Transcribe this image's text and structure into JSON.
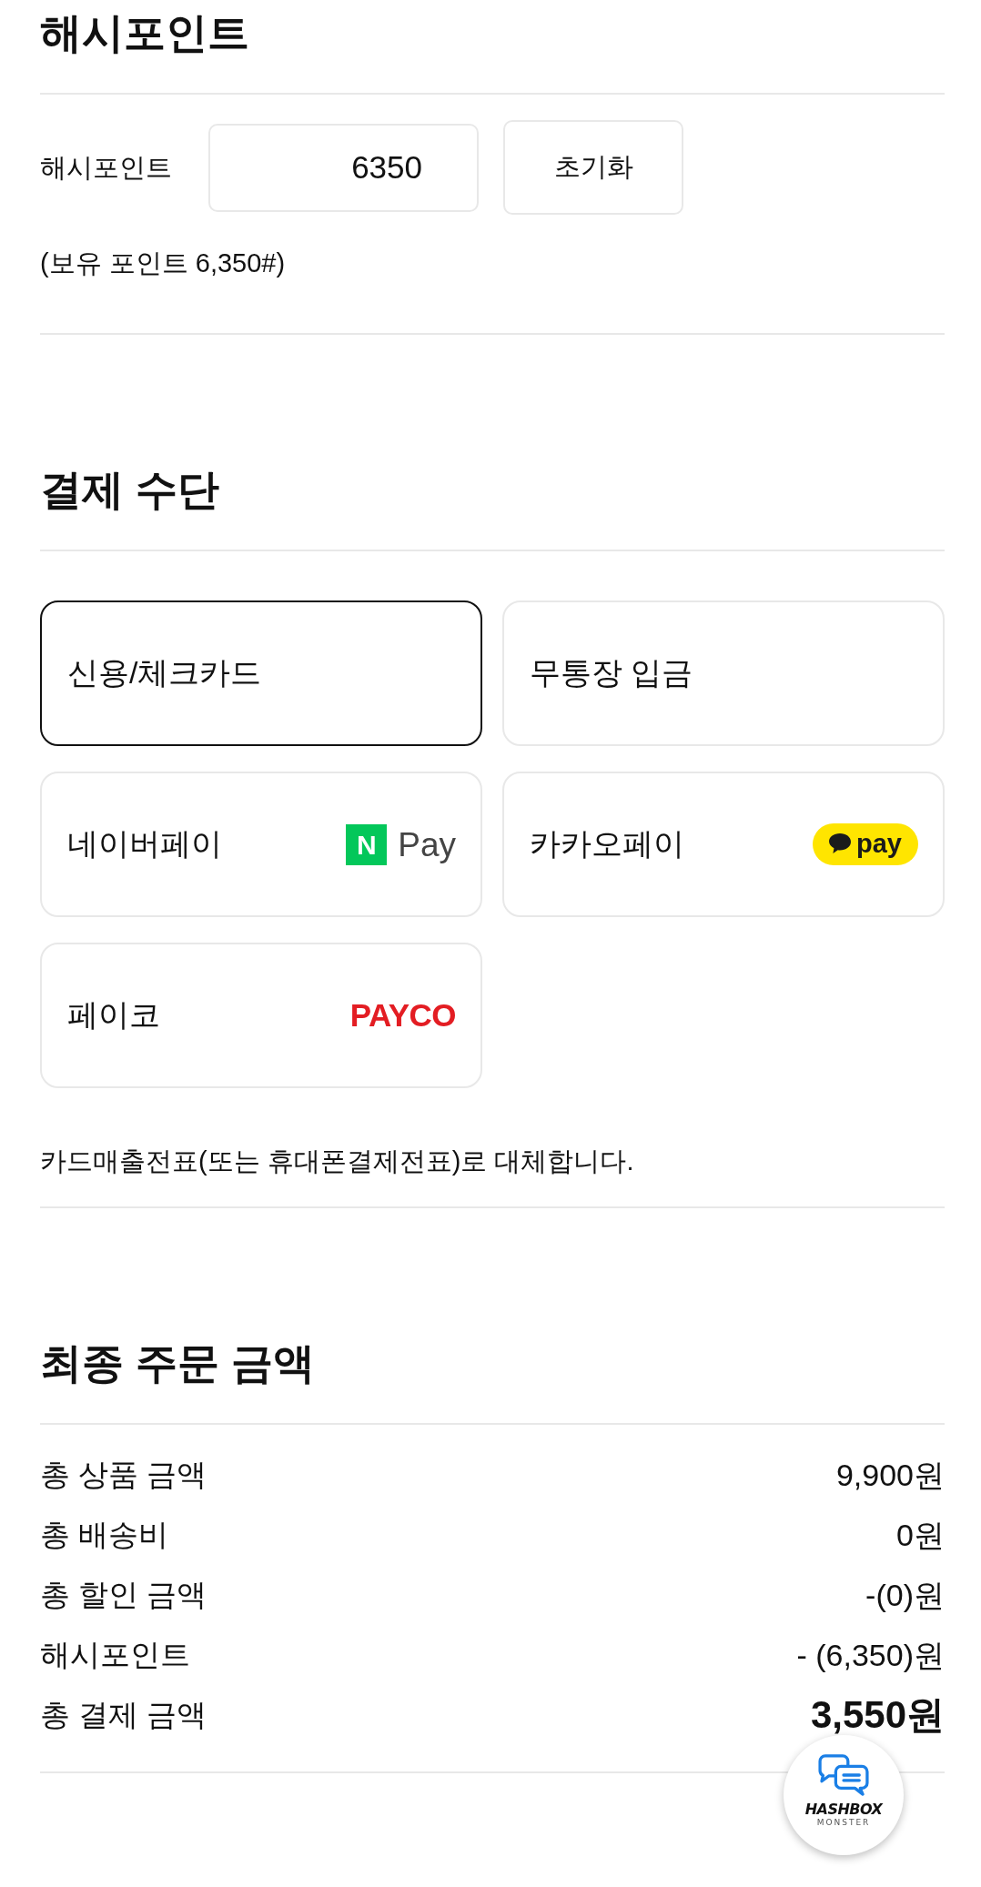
{
  "points_section": {
    "title": "해시포인트",
    "field_label": "해시포인트",
    "field": {
      "value": "6350"
    },
    "reset_button": "초기화",
    "balance_note": "(보유 포인트 6,350#)"
  },
  "payment_section": {
    "title": "결제 수단",
    "methods": [
      {
        "label": "신용/체크카드",
        "selected": true
      },
      {
        "label": "무통장 입금",
        "selected": false
      },
      {
        "label": "네이버페이",
        "selected": false,
        "logo": {
          "kind": "naverpay",
          "mark": "N",
          "text": "Pay"
        }
      },
      {
        "label": "카카오페이",
        "selected": false,
        "logo": {
          "kind": "kakaopay",
          "text": "pay"
        }
      },
      {
        "label": "페이코",
        "selected": false,
        "logo": {
          "kind": "payco",
          "text": "PAYCO"
        }
      }
    ],
    "note": "카드매출전표(또는 휴대폰결제전표)로 대체합니다."
  },
  "order_total_section": {
    "title": "최종 주문 금액",
    "rows": [
      {
        "kind": "line",
        "label": "총 상품 금액",
        "value": "9,900원"
      },
      {
        "kind": "line",
        "label": "총 배송비",
        "value": "0원"
      },
      {
        "kind": "line",
        "label": "총 할인 금액",
        "value": "-(0)원"
      },
      {
        "kind": "line",
        "label": "해시포인트",
        "value": "- (6,350)원"
      },
      {
        "kind": "total",
        "label": "총 결제 금액",
        "value": "3,550원"
      }
    ]
  },
  "chat_button": {
    "logo_text": "HASHBOX",
    "logo_subtext": "MONSTER"
  }
}
